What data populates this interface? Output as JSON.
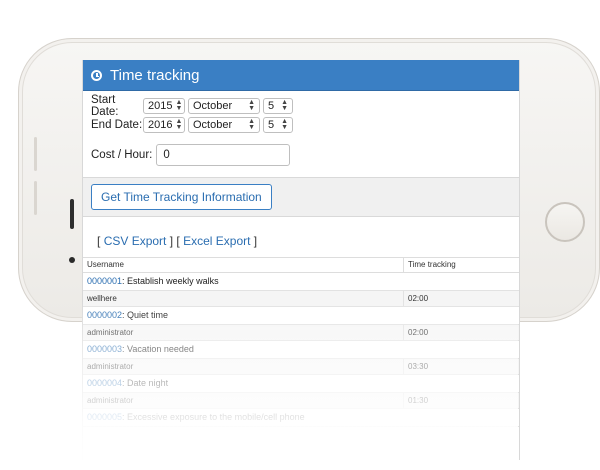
{
  "panel": {
    "title": "Time tracking"
  },
  "form": {
    "start": {
      "label": "Start Date:",
      "year": "2015",
      "month": "October",
      "day": "5"
    },
    "end": {
      "label": "End Date:",
      "year": "2016",
      "month": "October",
      "day": "5"
    },
    "cost": {
      "label": "Cost / Hour:",
      "value": "0"
    },
    "submit_label": "Get Time Tracking Information"
  },
  "export": {
    "open1": "[",
    "csv": "CSV Export",
    "sep": "] [",
    "excel": "Excel Export",
    "close": "]"
  },
  "table": {
    "headers": [
      "Username",
      "Time tracking"
    ],
    "rows": [
      {
        "id": "0000001",
        "summary": ": Establish weekly walks",
        "user": "wellhere",
        "time": "02:00"
      },
      {
        "id": "0000002",
        "summary": ": Quiet time",
        "user": "administrator",
        "time": "02:00"
      },
      {
        "id": "0000003",
        "summary": ": Vacation needed",
        "user": "administrator",
        "time": "03:30"
      },
      {
        "id": "0000004",
        "summary": ": Date night",
        "user": "administrator",
        "time": "01:30"
      },
      {
        "id": "0000005",
        "summary": ": Excessive exposure to the mobile/cell phone",
        "user": "",
        "time": ""
      }
    ]
  },
  "colors": {
    "accent": "#3a7fc4",
    "link": "#2a6db0"
  },
  "icons": {
    "header": "clock-icon"
  }
}
